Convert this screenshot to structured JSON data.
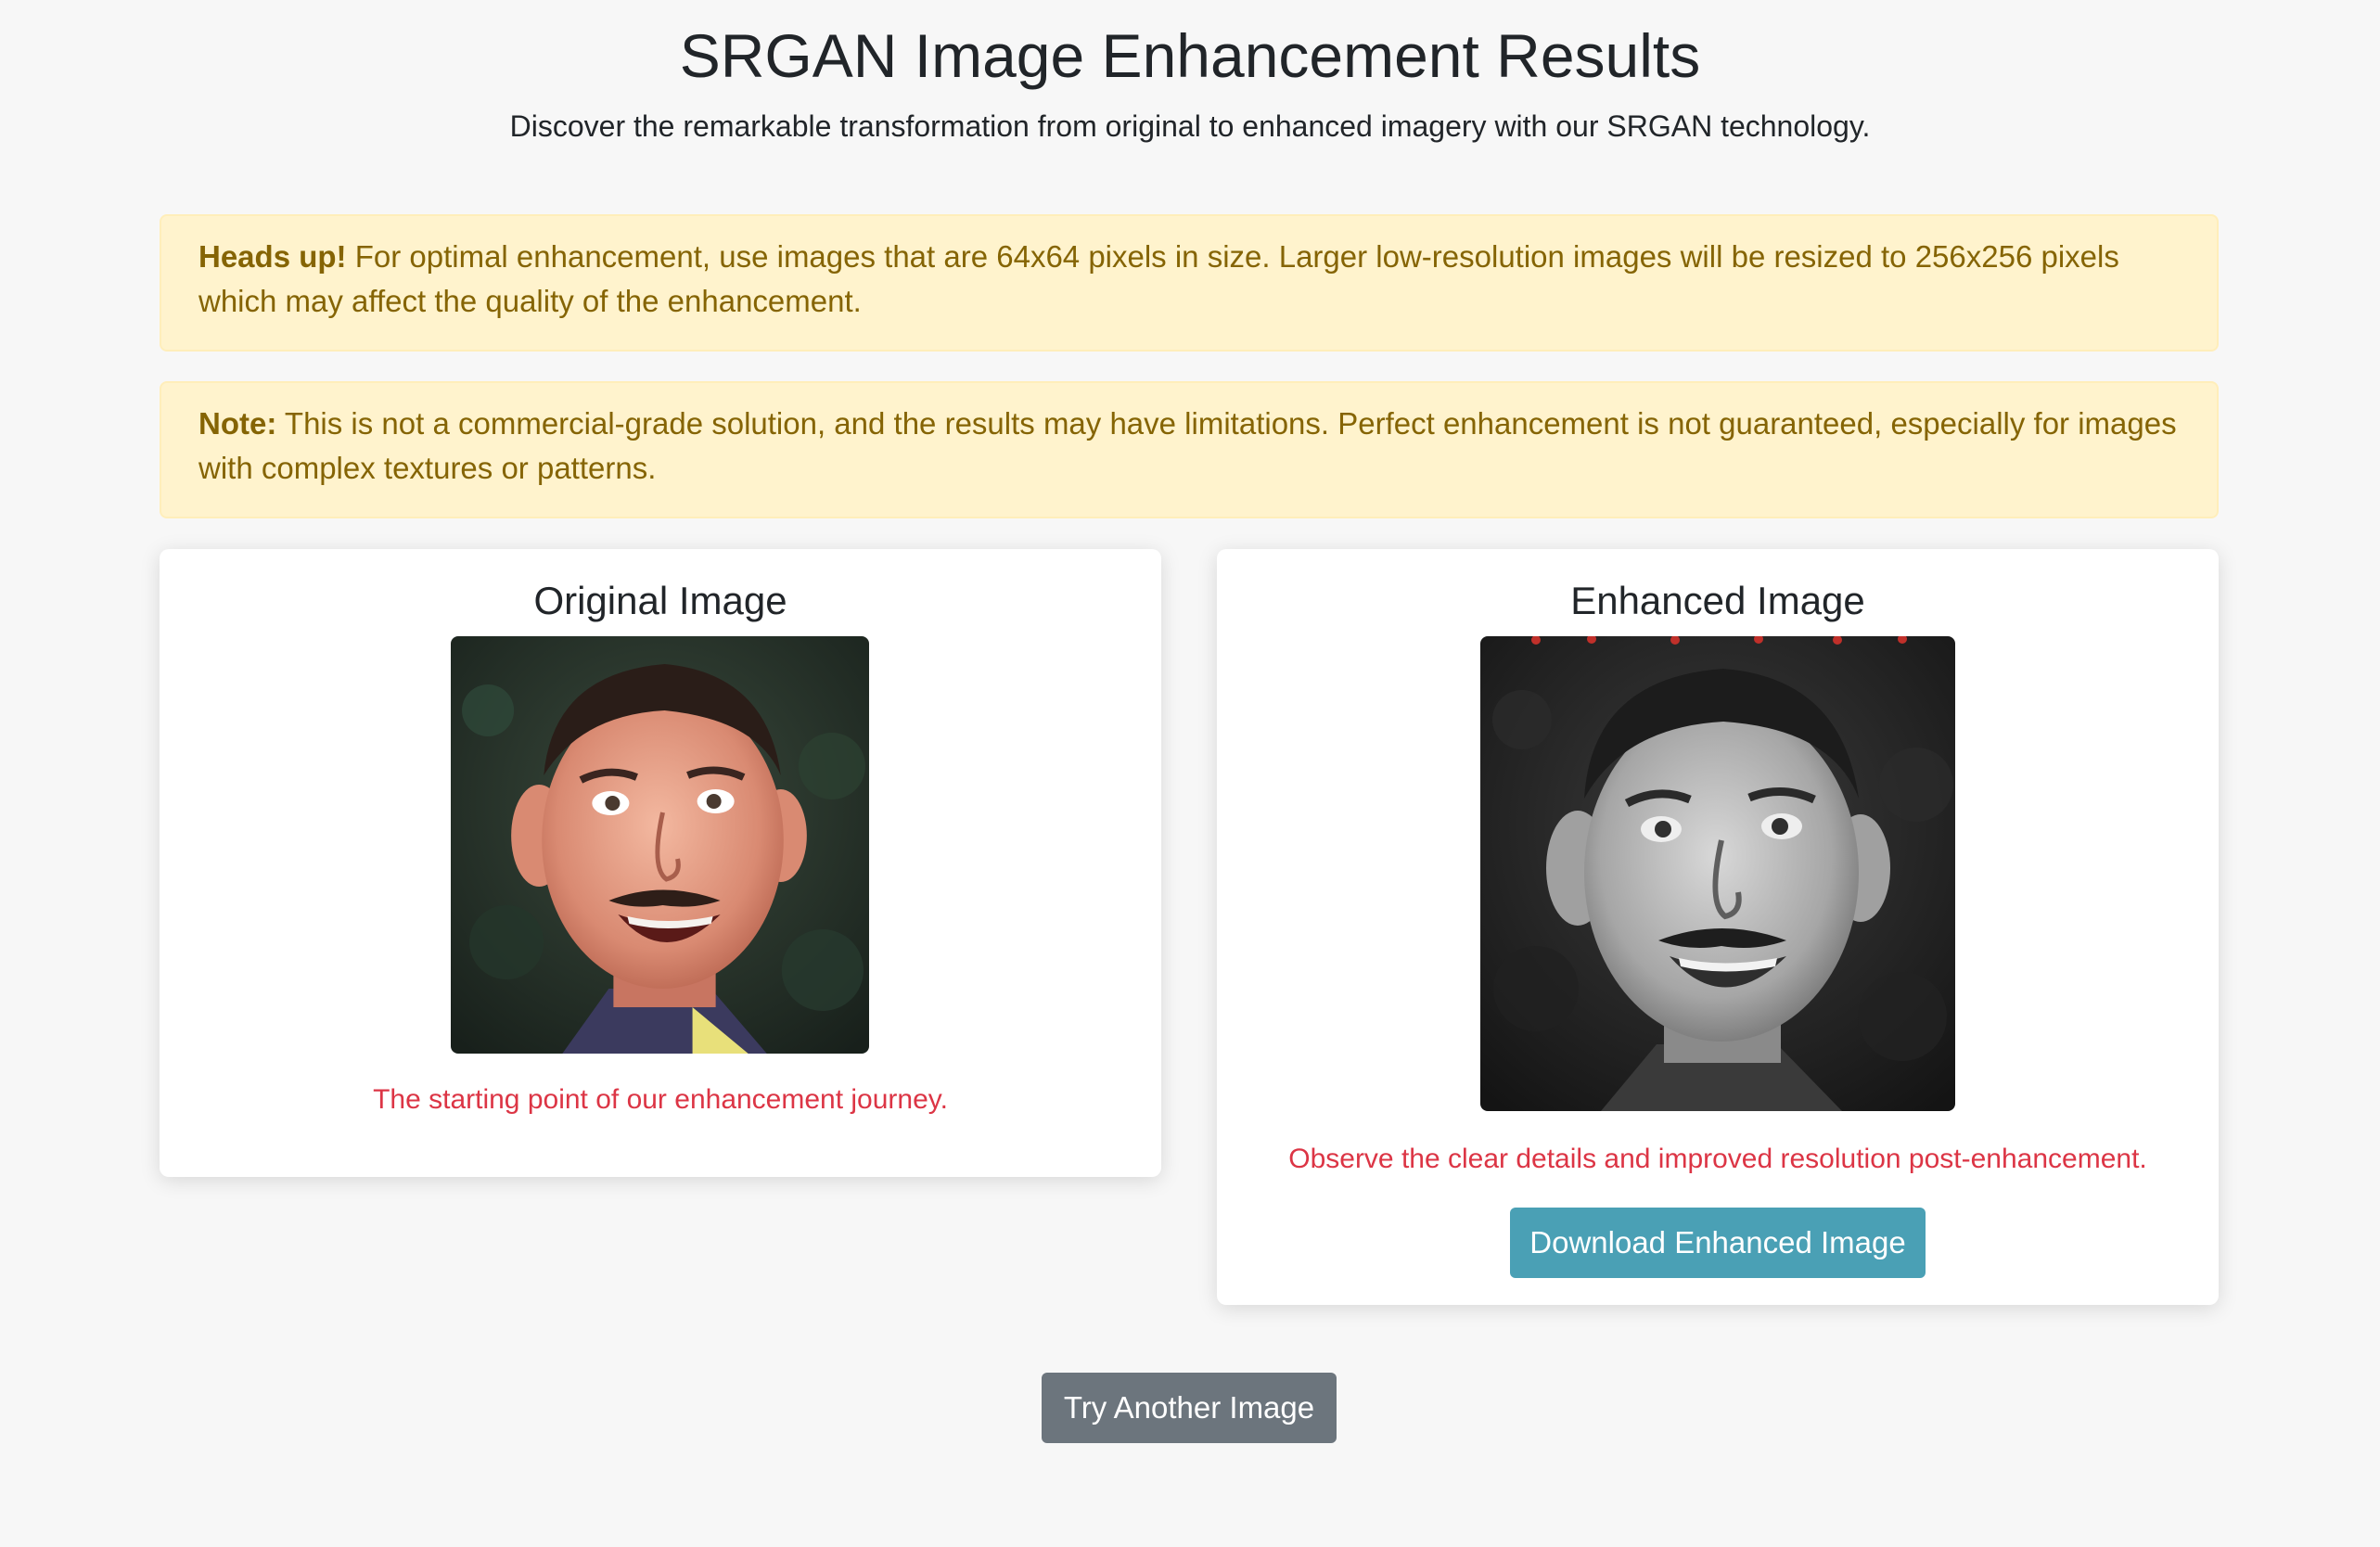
{
  "header": {
    "title": "SRGAN Image Enhancement Results",
    "subtitle": "Discover the remarkable transformation from original to enhanced imagery with our SRGAN technology."
  },
  "alerts": [
    {
      "label": "Heads up!",
      "text": "For optimal enhancement, use images that are 64x64 pixels in size. Larger low-resolution images will be resized to 256x256 pixels which may affect the quality of the enhancement."
    },
    {
      "label": "Note:",
      "text": "This is not a commercial-grade solution, and the results may have limitations. Perfect enhancement is not guaranteed, especially for images with complex textures or patterns."
    }
  ],
  "original": {
    "title": "Original Image",
    "caption": "The starting point of our enhancement journey."
  },
  "enhanced": {
    "title": "Enhanced Image",
    "caption": "Observe the clear details and improved resolution post-enhancement.",
    "download_label": "Download Enhanced Image"
  },
  "actions": {
    "try_another_label": "Try Another Image"
  },
  "colors": {
    "page_background": "#f7f7f7",
    "alert_background": "#fff3cd",
    "alert_text": "#856404",
    "caption_text": "#dc3545",
    "download_button": "#4aa0b5",
    "try_button": "#6c757d"
  }
}
